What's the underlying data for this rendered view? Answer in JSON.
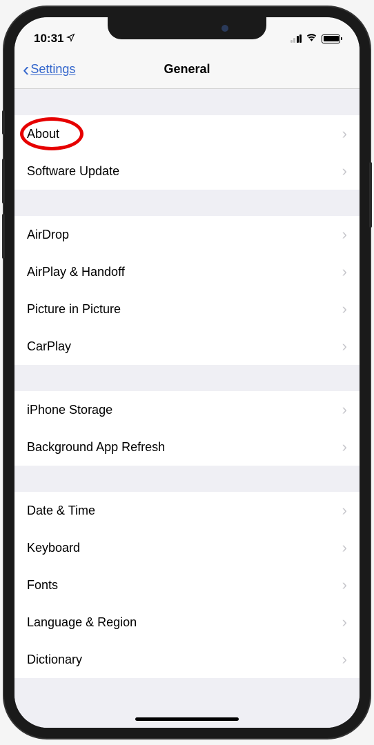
{
  "statusBar": {
    "time": "10:31"
  },
  "navBar": {
    "backLabel": "Settings",
    "title": "General"
  },
  "sections": [
    {
      "rows": [
        {
          "label": "About",
          "highlighted": true
        },
        {
          "label": "Software Update"
        }
      ]
    },
    {
      "rows": [
        {
          "label": "AirDrop"
        },
        {
          "label": "AirPlay & Handoff"
        },
        {
          "label": "Picture in Picture"
        },
        {
          "label": "CarPlay"
        }
      ]
    },
    {
      "rows": [
        {
          "label": "iPhone Storage"
        },
        {
          "label": "Background App Refresh"
        }
      ]
    },
    {
      "rows": [
        {
          "label": "Date & Time"
        },
        {
          "label": "Keyboard"
        },
        {
          "label": "Fonts"
        },
        {
          "label": "Language & Region"
        },
        {
          "label": "Dictionary"
        }
      ]
    }
  ]
}
